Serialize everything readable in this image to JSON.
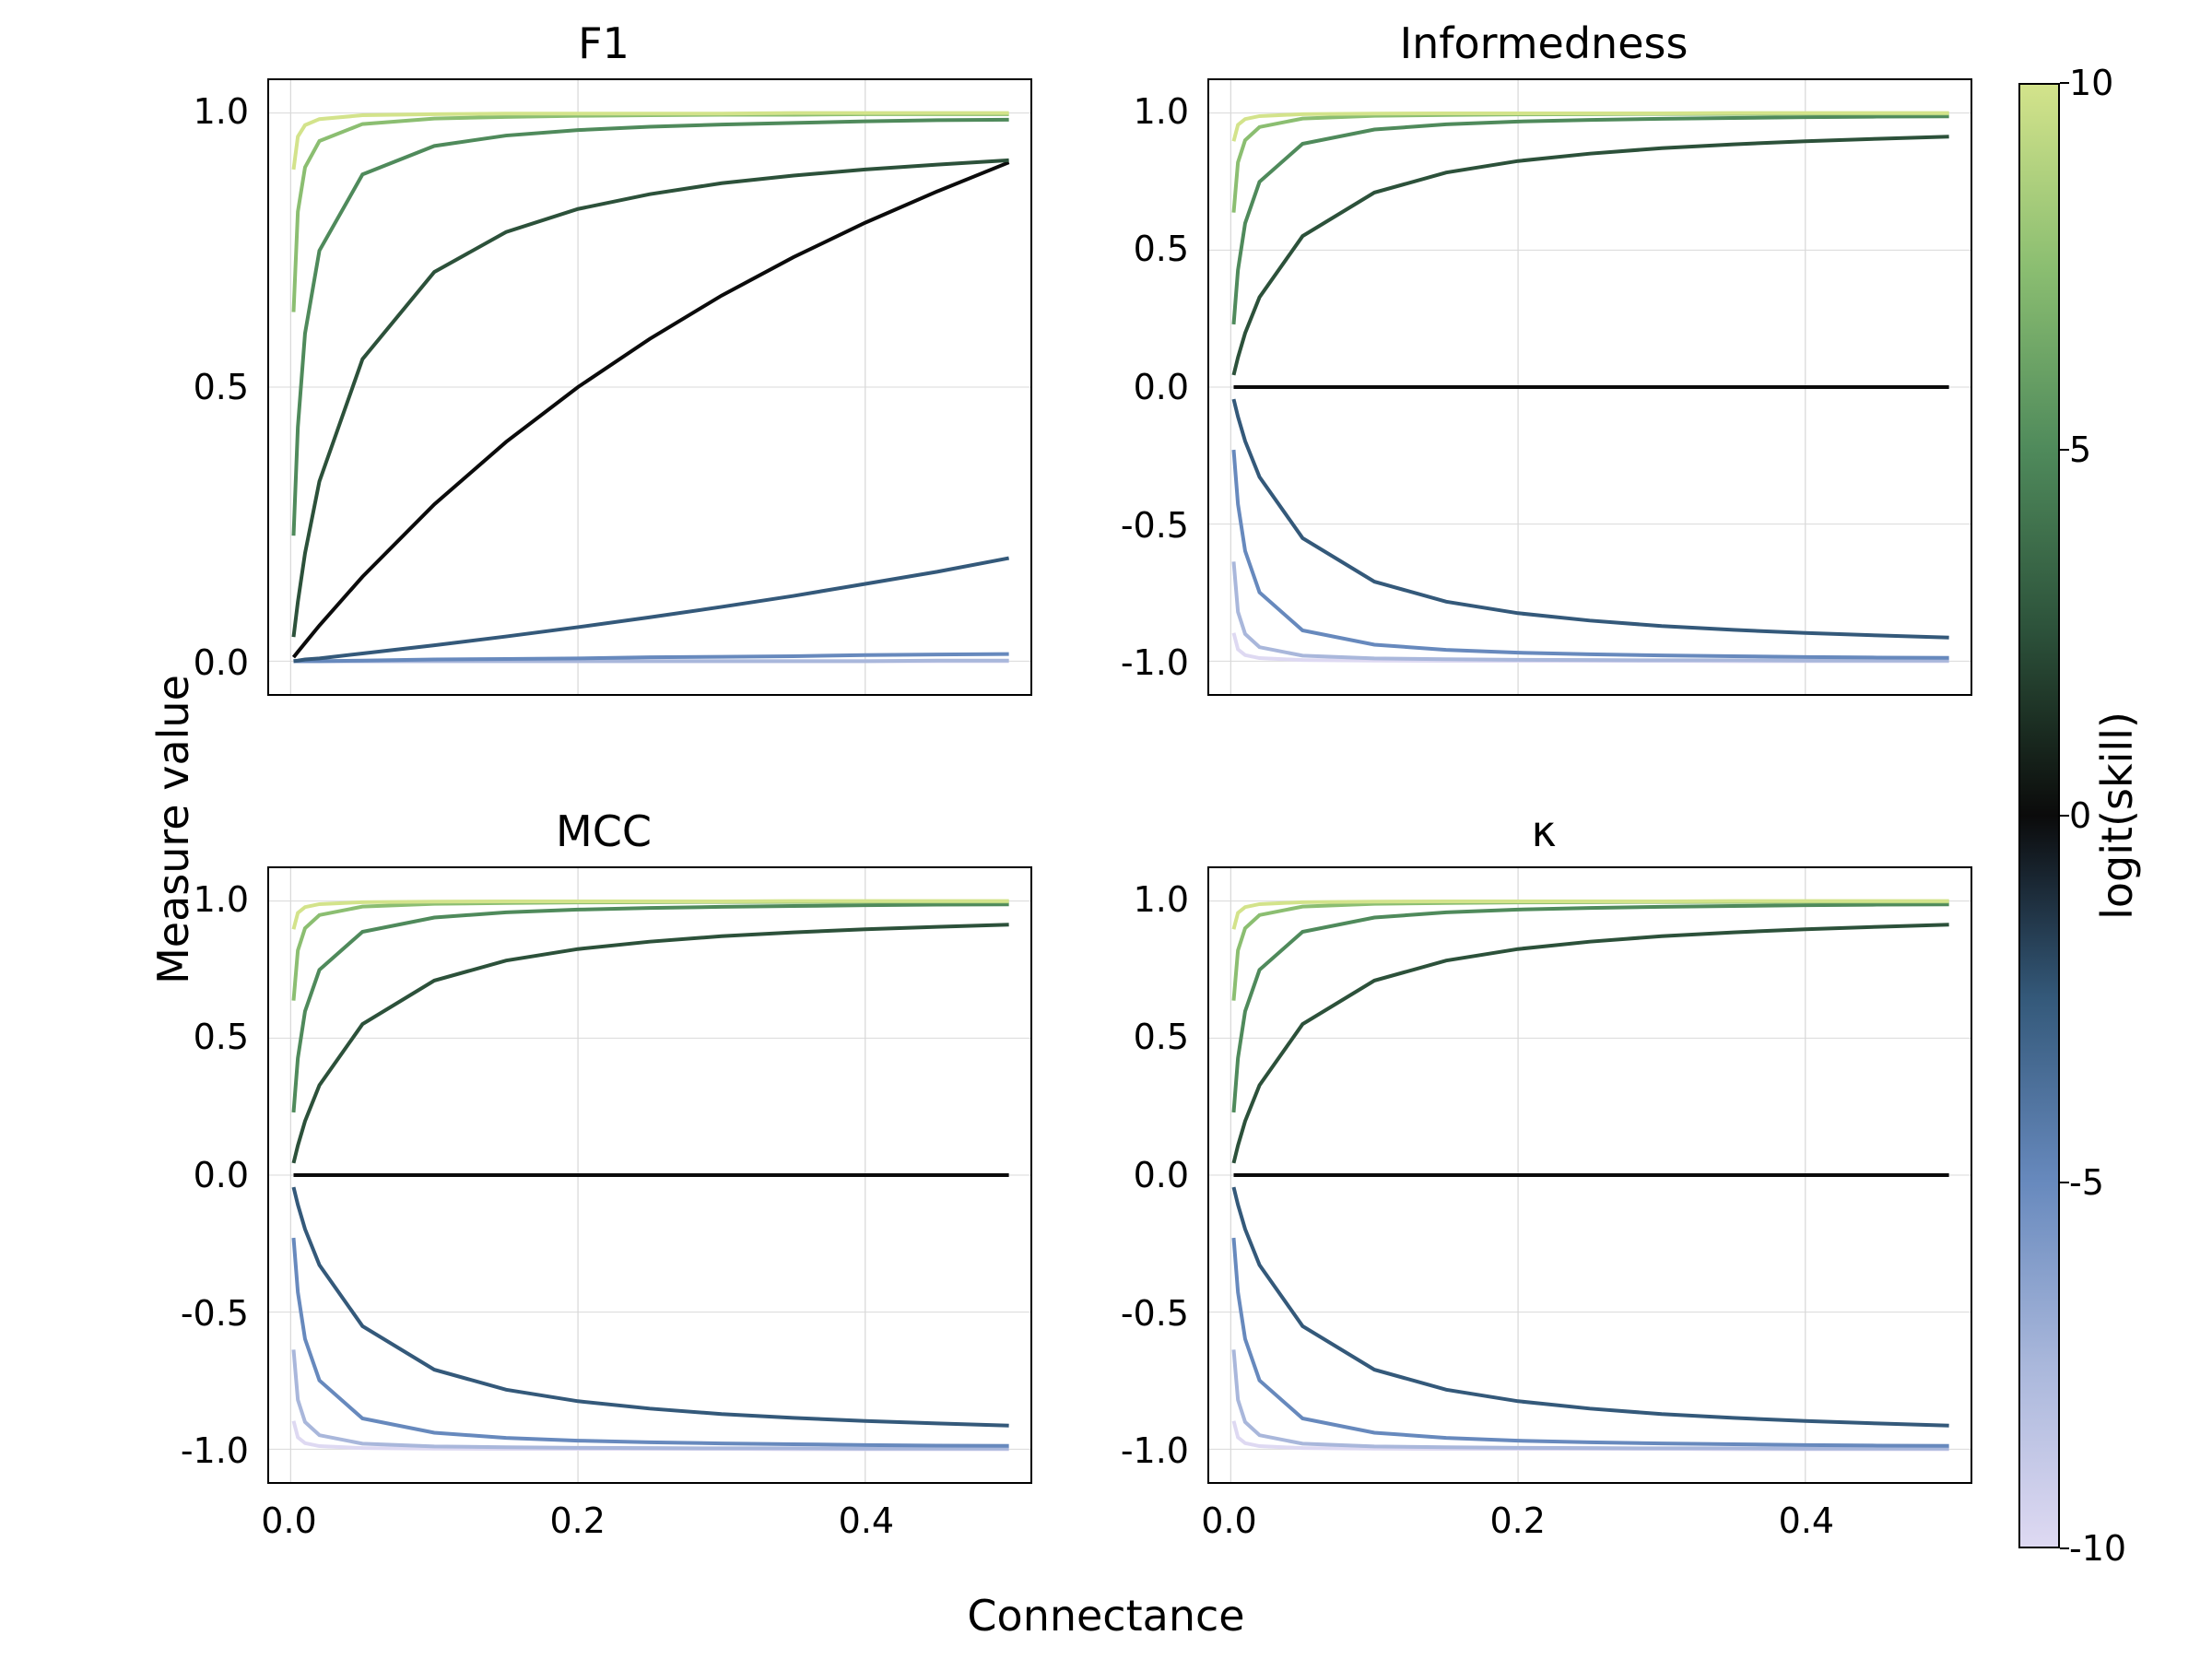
{
  "axis_labels": {
    "x": "Connectance",
    "y": "Measure value"
  },
  "x_range": [
    -0.015,
    0.515
  ],
  "x_ticks": [
    0.0,
    0.2,
    0.4
  ],
  "panels": [
    {
      "key": "F1",
      "title": "F1",
      "y_range": [
        -0.06,
        1.06
      ],
      "y_ticks": [
        0.0,
        0.5,
        1.0
      ]
    },
    {
      "key": "Informedness",
      "title": "Informedness",
      "y_range": [
        -1.12,
        1.12
      ],
      "y_ticks": [
        -1.0,
        -0.5,
        0.0,
        0.5,
        1.0
      ]
    },
    {
      "key": "MCC",
      "title": "MCC",
      "y_range": [
        -1.12,
        1.12
      ],
      "y_ticks": [
        -1.0,
        -0.5,
        0.0,
        0.5,
        1.0
      ]
    },
    {
      "key": "Kappa",
      "title": "κ",
      "y_range": [
        -1.12,
        1.12
      ],
      "y_ticks": [
        -1.0,
        -0.5,
        0.0,
        0.5,
        1.0
      ]
    }
  ],
  "skill_levels": [
    -10,
    -7.5,
    -5,
    -2.5,
    0,
    2.5,
    5,
    7.5,
    10
  ],
  "skill_colors": {
    "-10": "#ded9f2",
    "-7.5": "#a9b7db",
    "-5": "#6789bd",
    "-2.5": "#34597a",
    "0": "#0b0b0b",
    "2.5": "#2c513a",
    "5": "#4f8a5b",
    "7.5": "#8bbe71",
    "10": "#d3e38b"
  },
  "colorbar": {
    "title": "logit(skill)",
    "range": [
      -10,
      10
    ],
    "ticks": [
      -10,
      -5,
      0,
      5,
      10
    ],
    "stops": [
      {
        "p": 0,
        "c": "#ded9f2"
      },
      {
        "p": 12.5,
        "c": "#a9b7db"
      },
      {
        "p": 25,
        "c": "#6789bd"
      },
      {
        "p": 37.5,
        "c": "#34597a"
      },
      {
        "p": 50,
        "c": "#0b0b0b"
      },
      {
        "p": 62.5,
        "c": "#2c513a"
      },
      {
        "p": 75,
        "c": "#4f8a5b"
      },
      {
        "p": 87.5,
        "c": "#8bbe71"
      },
      {
        "p": 100,
        "c": "#d3e38b"
      }
    ]
  },
  "chart_data": [
    {
      "type": "line",
      "title": "F1",
      "xlabel": "Connectance",
      "ylabel": "Measure value",
      "xlim": [
        0,
        0.5
      ],
      "ylim": [
        0,
        1
      ],
      "x": [
        0.002,
        0.005,
        0.01,
        0.02,
        0.05,
        0.1,
        0.15,
        0.2,
        0.25,
        0.3,
        0.35,
        0.4,
        0.45,
        0.5
      ],
      "series": [
        {
          "name": "logit(skill)=-10",
          "values": [
            0,
            0,
            0,
            0,
            0,
            0,
            0,
            0,
            0,
            0,
            0,
            0,
            0,
            0
          ]
        },
        {
          "name": "logit(skill)=-7.5",
          "values": [
            0,
            0,
            0,
            0,
            0,
            0,
            0,
            0,
            0,
            0,
            0,
            0,
            0.001,
            0.001
          ]
        },
        {
          "name": "logit(skill)=-5",
          "values": [
            0,
            0,
            0,
            0,
            0.001,
            0.003,
            0.004,
            0.005,
            0.007,
            0.008,
            0.009,
            0.011,
            0.012,
            0.013
          ]
        },
        {
          "name": "logit(skill)=-2.5",
          "values": [
            0,
            0.001,
            0.003,
            0.005,
            0.014,
            0.029,
            0.045,
            0.062,
            0.08,
            0.099,
            0.119,
            0.141,
            0.163,
            0.188
          ]
        },
        {
          "name": "logit(skill)=0",
          "values": [
            0.007,
            0.017,
            0.033,
            0.065,
            0.154,
            0.286,
            0.4,
            0.5,
            0.588,
            0.667,
            0.737,
            0.8,
            0.857,
            0.91
          ]
        },
        {
          "name": "logit(skill)=2.5",
          "values": [
            0.044,
            0.108,
            0.197,
            0.328,
            0.551,
            0.71,
            0.783,
            0.825,
            0.852,
            0.872,
            0.886,
            0.897,
            0.906,
            0.914
          ]
        },
        {
          "name": "logit(skill)=5",
          "values": [
            0.229,
            0.427,
            0.598,
            0.749,
            0.888,
            0.94,
            0.959,
            0.969,
            0.975,
            0.979,
            0.982,
            0.985,
            0.987,
            0.988
          ]
        },
        {
          "name": "logit(skill)=7.5",
          "values": [
            0.637,
            0.82,
            0.901,
            0.949,
            0.98,
            0.99,
            0.993,
            0.995,
            0.996,
            0.997,
            0.997,
            0.998,
            0.998,
            0.998
          ]
        },
        {
          "name": "logit(skill)=10",
          "values": [
            0.897,
            0.957,
            0.978,
            0.989,
            0.996,
            0.998,
            0.999,
            0.999,
            0.999,
            0.999,
            1,
            1,
            1,
            1
          ]
        }
      ]
    },
    {
      "type": "line",
      "title": "Informedness",
      "xlabel": "Connectance",
      "ylabel": "Measure value",
      "xlim": [
        0,
        0.5
      ],
      "ylim": [
        -1,
        1
      ],
      "x": [
        0.002,
        0.005,
        0.01,
        0.02,
        0.05,
        0.1,
        0.15,
        0.2,
        0.25,
        0.3,
        0.35,
        0.4,
        0.45,
        0.5
      ],
      "series": [
        {
          "name": "-10",
          "values": [
            -0.897,
            -0.957,
            -0.978,
            -0.989,
            -0.996,
            -0.998,
            -0.999,
            -0.999,
            -0.999,
            -0.999,
            -1,
            -1,
            -1,
            -1
          ]
        },
        {
          "name": "-7.5",
          "values": [
            -0.637,
            -0.82,
            -0.901,
            -0.949,
            -0.98,
            -0.99,
            -0.993,
            -0.995,
            -0.996,
            -0.997,
            -0.997,
            -0.998,
            -0.998,
            -0.998
          ]
        },
        {
          "name": "-5",
          "values": [
            -0.229,
            -0.427,
            -0.598,
            -0.749,
            -0.888,
            -0.94,
            -0.959,
            -0.969,
            -0.975,
            -0.979,
            -0.982,
            -0.985,
            -0.987,
            -0.988
          ]
        },
        {
          "name": "-2.5",
          "values": [
            -0.044,
            -0.108,
            -0.197,
            -0.328,
            -0.551,
            -0.71,
            -0.783,
            -0.825,
            -0.852,
            -0.872,
            -0.886,
            -0.897,
            -0.906,
            -0.914
          ]
        },
        {
          "name": "0",
          "values": [
            0,
            0,
            0,
            0,
            0,
            0,
            0,
            0,
            0,
            0,
            0,
            0,
            0,
            0
          ]
        },
        {
          "name": "2.5",
          "values": [
            0.044,
            0.108,
            0.197,
            0.328,
            0.551,
            0.71,
            0.783,
            0.825,
            0.852,
            0.872,
            0.886,
            0.897,
            0.906,
            0.914
          ]
        },
        {
          "name": "5",
          "values": [
            0.229,
            0.427,
            0.598,
            0.749,
            0.888,
            0.94,
            0.959,
            0.969,
            0.975,
            0.979,
            0.982,
            0.985,
            0.987,
            0.988
          ]
        },
        {
          "name": "7.5",
          "values": [
            0.637,
            0.82,
            0.901,
            0.949,
            0.98,
            0.99,
            0.993,
            0.995,
            0.996,
            0.997,
            0.997,
            0.998,
            0.998,
            0.998
          ]
        },
        {
          "name": "10",
          "values": [
            0.897,
            0.957,
            0.978,
            0.989,
            0.996,
            0.998,
            0.999,
            0.999,
            0.999,
            0.999,
            1,
            1,
            1,
            1
          ]
        }
      ]
    },
    {
      "type": "line",
      "title": "MCC",
      "xlabel": "Connectance",
      "ylabel": "Measure value",
      "xlim": [
        0,
        0.5
      ],
      "ylim": [
        -1,
        1
      ],
      "x": [
        0.002,
        0.005,
        0.01,
        0.02,
        0.05,
        0.1,
        0.15,
        0.2,
        0.25,
        0.3,
        0.35,
        0.4,
        0.45,
        0.5
      ],
      "series": [
        {
          "name": "-10",
          "values": [
            -0.897,
            -0.957,
            -0.978,
            -0.989,
            -0.996,
            -0.998,
            -0.999,
            -0.999,
            -0.999,
            -0.999,
            -1,
            -1,
            -1,
            -1
          ]
        },
        {
          "name": "-7.5",
          "values": [
            -0.637,
            -0.82,
            -0.901,
            -0.949,
            -0.98,
            -0.99,
            -0.993,
            -0.995,
            -0.996,
            -0.997,
            -0.997,
            -0.998,
            -0.998,
            -0.998
          ]
        },
        {
          "name": "-5",
          "values": [
            -0.229,
            -0.427,
            -0.598,
            -0.749,
            -0.888,
            -0.94,
            -0.959,
            -0.969,
            -0.975,
            -0.979,
            -0.982,
            -0.985,
            -0.987,
            -0.988
          ]
        },
        {
          "name": "-2.5",
          "values": [
            -0.044,
            -0.108,
            -0.197,
            -0.328,
            -0.551,
            -0.71,
            -0.783,
            -0.825,
            -0.852,
            -0.872,
            -0.886,
            -0.897,
            -0.906,
            -0.914
          ]
        },
        {
          "name": "0",
          "values": [
            0,
            0,
            0,
            0,
            0,
            0,
            0,
            0,
            0,
            0,
            0,
            0,
            0,
            0
          ]
        },
        {
          "name": "2.5",
          "values": [
            0.044,
            0.108,
            0.197,
            0.328,
            0.551,
            0.71,
            0.783,
            0.825,
            0.852,
            0.872,
            0.886,
            0.897,
            0.906,
            0.914
          ]
        },
        {
          "name": "5",
          "values": [
            0.229,
            0.427,
            0.598,
            0.749,
            0.888,
            0.94,
            0.959,
            0.969,
            0.975,
            0.979,
            0.982,
            0.985,
            0.987,
            0.988
          ]
        },
        {
          "name": "7.5",
          "values": [
            0.637,
            0.82,
            0.901,
            0.949,
            0.98,
            0.99,
            0.993,
            0.995,
            0.996,
            0.997,
            0.997,
            0.998,
            0.998,
            0.998
          ]
        },
        {
          "name": "10",
          "values": [
            0.897,
            0.957,
            0.978,
            0.989,
            0.996,
            0.998,
            0.999,
            0.999,
            0.999,
            0.999,
            1,
            1,
            1,
            1
          ]
        }
      ]
    },
    {
      "type": "line",
      "title": "κ",
      "xlabel": "Connectance",
      "ylabel": "Measure value",
      "xlim": [
        0,
        0.5
      ],
      "ylim": [
        -1,
        1
      ],
      "x": [
        0.002,
        0.005,
        0.01,
        0.02,
        0.05,
        0.1,
        0.15,
        0.2,
        0.25,
        0.3,
        0.35,
        0.4,
        0.45,
        0.5
      ],
      "series": [
        {
          "name": "-10",
          "values": [
            -0.897,
            -0.957,
            -0.978,
            -0.989,
            -0.996,
            -0.998,
            -0.999,
            -0.999,
            -0.999,
            -0.999,
            -1,
            -1,
            -1,
            -1
          ]
        },
        {
          "name": "-7.5",
          "values": [
            -0.637,
            -0.82,
            -0.901,
            -0.949,
            -0.98,
            -0.99,
            -0.993,
            -0.995,
            -0.996,
            -0.997,
            -0.997,
            -0.998,
            -0.998,
            -0.998
          ]
        },
        {
          "name": "-5",
          "values": [
            -0.229,
            -0.427,
            -0.598,
            -0.749,
            -0.888,
            -0.94,
            -0.959,
            -0.969,
            -0.975,
            -0.979,
            -0.982,
            -0.985,
            -0.987,
            -0.988
          ]
        },
        {
          "name": "-2.5",
          "values": [
            -0.044,
            -0.108,
            -0.197,
            -0.328,
            -0.551,
            -0.71,
            -0.783,
            -0.825,
            -0.852,
            -0.872,
            -0.886,
            -0.897,
            -0.906,
            -0.914
          ]
        },
        {
          "name": "0",
          "values": [
            0,
            0,
            0,
            0,
            0,
            0,
            0,
            0,
            0,
            0,
            0,
            0,
            0,
            0
          ]
        },
        {
          "name": "2.5",
          "values": [
            0.044,
            0.108,
            0.197,
            0.328,
            0.551,
            0.71,
            0.783,
            0.825,
            0.852,
            0.872,
            0.886,
            0.897,
            0.906,
            0.914
          ]
        },
        {
          "name": "5",
          "values": [
            0.229,
            0.427,
            0.598,
            0.749,
            0.888,
            0.94,
            0.959,
            0.969,
            0.975,
            0.979,
            0.982,
            0.985,
            0.987,
            0.988
          ]
        },
        {
          "name": "7.5",
          "values": [
            0.637,
            0.82,
            0.901,
            0.949,
            0.98,
            0.99,
            0.993,
            0.995,
            0.996,
            0.997,
            0.997,
            0.998,
            0.998,
            0.998
          ]
        },
        {
          "name": "10",
          "values": [
            0.897,
            0.957,
            0.978,
            0.989,
            0.996,
            0.998,
            0.999,
            0.999,
            0.999,
            0.999,
            1,
            1,
            1,
            1
          ]
        }
      ]
    }
  ]
}
